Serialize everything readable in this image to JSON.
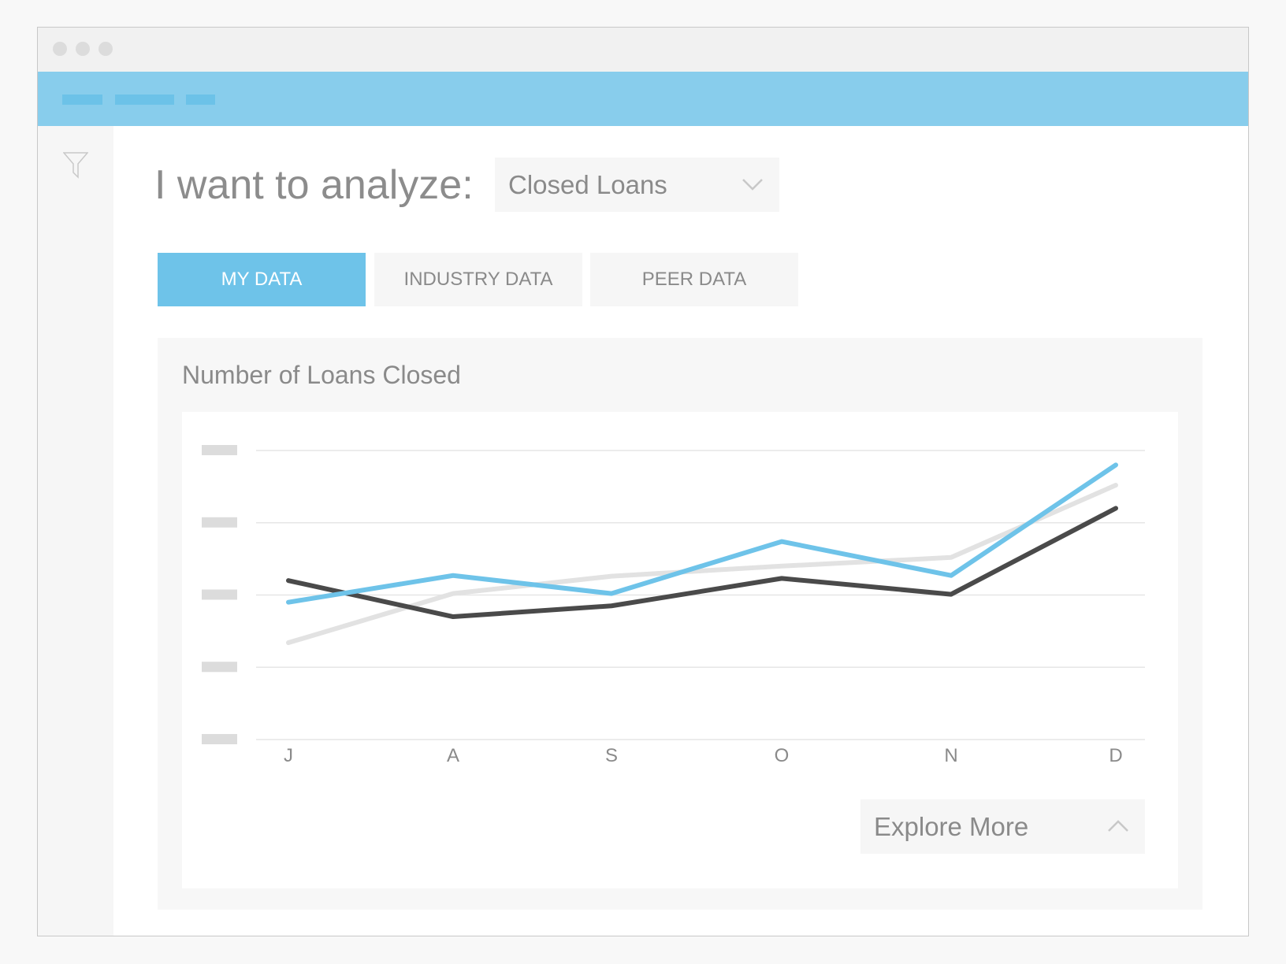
{
  "header": {
    "title": "I want to analyze:"
  },
  "dropdown": {
    "selected": "Closed Loans",
    "icon": "chevron-down-icon"
  },
  "tabs": [
    {
      "label": "MY DATA",
      "active": true
    },
    {
      "label": "INDUSTRY DATA",
      "active": false
    },
    {
      "label": "PEER DATA",
      "active": false
    }
  ],
  "sidebar": {
    "icon": "filter-icon"
  },
  "explore": {
    "label": "Explore More",
    "icon": "chevron-up-icon"
  },
  "colors": {
    "accent": "#6ec3e9",
    "navbar": "#88cdec",
    "dark_series": "#4a4a4a",
    "light_series": "#e2e2e2"
  },
  "chart_data": {
    "type": "line",
    "title": "Number of Loans Closed",
    "categories": [
      "J",
      "A",
      "S",
      "O",
      "N",
      "D"
    ],
    "ylim": [
      0,
      4
    ],
    "y_tick_labels_hidden": true,
    "grid": true,
    "series": [
      {
        "color": "#e2e2e2",
        "values": [
          1.34,
          2.02,
          2.26,
          2.4,
          2.52,
          3.52
        ]
      },
      {
        "color": "#4a4a4a",
        "values": [
          2.2,
          1.7,
          1.85,
          2.23,
          2.01,
          3.2
        ]
      },
      {
        "color": "#6ec3e9",
        "values": [
          1.9,
          2.27,
          2.02,
          2.74,
          2.27,
          3.8
        ]
      }
    ]
  }
}
